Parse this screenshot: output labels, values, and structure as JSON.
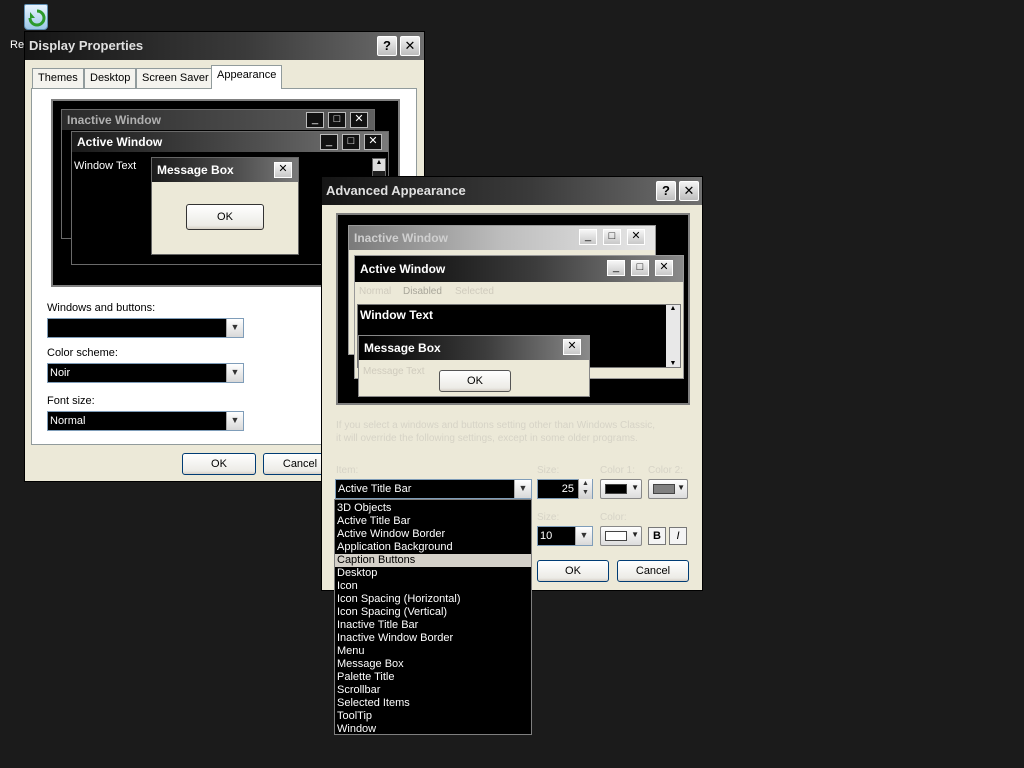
{
  "desktop": {
    "recycle_label": "Re"
  },
  "display_properties": {
    "title": "Display Properties",
    "help": "?",
    "close": "✕",
    "tabs": [
      "Themes",
      "Desktop",
      "Screen Saver",
      "Appearance"
    ],
    "preview": {
      "inactive_title": "Inactive Window",
      "active_title": "Active Window",
      "window_text": "Window Text",
      "message_box_title": "Message Box",
      "ok": "OK"
    },
    "windows_and_buttons_label": "Windows and buttons:",
    "windows_and_buttons_value": "",
    "color_scheme_label": "Color scheme:",
    "color_scheme_value": "Noir",
    "font_size_label": "Font size:",
    "font_size_value": "Normal",
    "ok": "OK",
    "cancel": "Cancel"
  },
  "advanced_appearance": {
    "title": "Advanced Appearance",
    "help": "?",
    "close": "✕",
    "preview": {
      "inactive_title": "Inactive Window",
      "active_title": "Active Window",
      "menu_normal": "Normal",
      "menu_disabled": "Disabled",
      "menu_selected": "Selected",
      "window_text": "Window Text",
      "message_box_title": "Message Box",
      "message_text": "Message Text",
      "ok": "OK"
    },
    "info_line1": "If you select a windows and buttons setting other than Windows Classic,",
    "info_line2": "it will override the following settings, except in some older programs.",
    "item_label": "Item:",
    "item_value": "Active Title Bar",
    "size_label": "Size:",
    "size_value": "25",
    "color1_label": "Color 1:",
    "color2_label": "Color 2:",
    "font_size_label": "Size:",
    "font_size_value": "10",
    "font_color_label": "Color:",
    "bold": "B",
    "italic": "I",
    "ok": "OK",
    "cancel": "Cancel",
    "item_options": [
      "3D Objects",
      "Active Title Bar",
      "Active Window Border",
      "Application Background",
      "Caption Buttons",
      "Desktop",
      "Icon",
      "Icon Spacing (Horizontal)",
      "Icon Spacing (Vertical)",
      "Inactive Title Bar",
      "Inactive Window Border",
      "Menu",
      "Message Box",
      "Palette Title",
      "Scrollbar",
      "Selected Items",
      "ToolTip",
      "Window"
    ],
    "highlighted_option": "Caption Buttons",
    "colors": {
      "color1": "#000000",
      "color2": "#808080",
      "font_color": "#ffffff"
    }
  }
}
